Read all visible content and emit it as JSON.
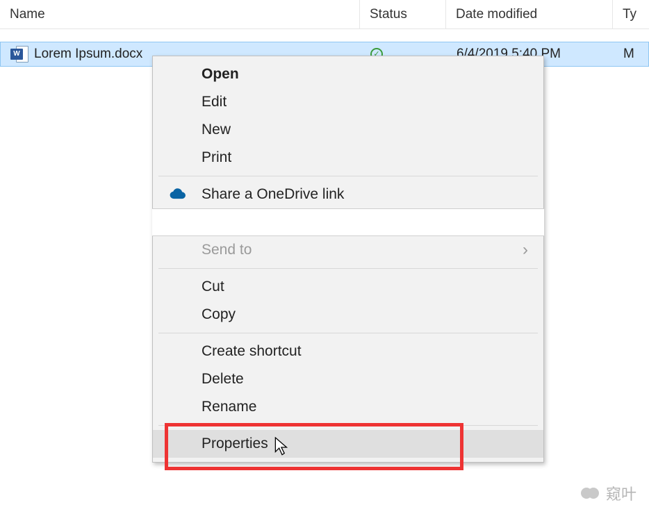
{
  "columns": {
    "name": "Name",
    "status": "Status",
    "date_modified": "Date modified",
    "type": "Ty"
  },
  "file": {
    "name": "Lorem Ipsum.docx",
    "status_icon": "sync-ok",
    "date_modified": "6/4/2019 5:40 PM",
    "type_abbrev": "M",
    "icon": "word-doc-icon"
  },
  "context_menu": {
    "items": [
      {
        "label": "Open",
        "bold": true,
        "interactable": true
      },
      {
        "label": "Edit",
        "interactable": true
      },
      {
        "label": "New",
        "interactable": true
      },
      {
        "label": "Print",
        "interactable": true
      },
      {
        "separator": true
      },
      {
        "label": "Share a OneDrive link",
        "icon": "onedrive-icon",
        "interactable": true
      },
      {
        "cutaway": true
      },
      {
        "label": "Send to",
        "submenu": true,
        "disabled": true,
        "interactable": true
      },
      {
        "separator": true
      },
      {
        "label": "Cut",
        "interactable": true
      },
      {
        "label": "Copy",
        "interactable": true
      },
      {
        "separator": true
      },
      {
        "label": "Create shortcut",
        "interactable": true
      },
      {
        "label": "Delete",
        "interactable": true
      },
      {
        "label": "Rename",
        "interactable": true
      },
      {
        "separator": true
      },
      {
        "label": "Properties",
        "hovered": true,
        "interactable": true
      }
    ]
  },
  "annotation": {
    "highlight_target": "menu-item-properties",
    "color": "#e33"
  },
  "watermark": {
    "text": "窥叶"
  }
}
